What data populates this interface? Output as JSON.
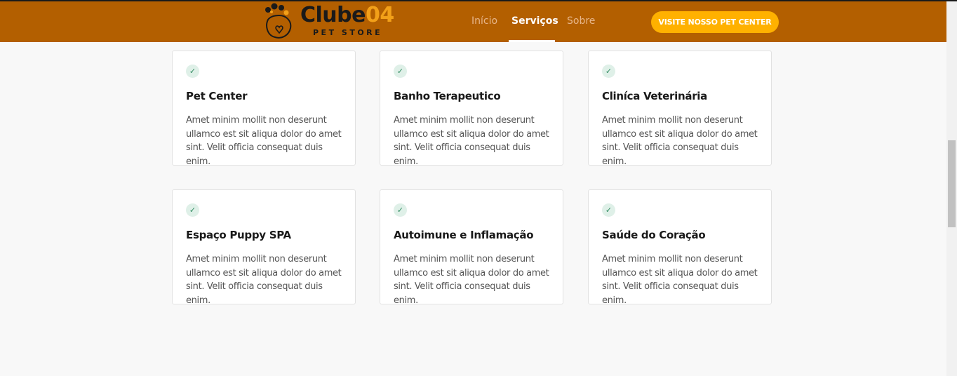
{
  "brand": {
    "name": "Clube",
    "name_number": "04",
    "tagline": "PET STORE"
  },
  "nav": {
    "items": [
      {
        "label": "Início",
        "active": false
      },
      {
        "label": "Serviços",
        "active": true
      },
      {
        "label": "Sobre",
        "active": false
      }
    ],
    "cta_label": "VISITE NOSSO PET CENTER"
  },
  "colors": {
    "header": "#b35f00",
    "cta": "#ffb100",
    "check_bg": "#dff0e8",
    "check": "#2f8a5f"
  },
  "services": [
    {
      "title": "Pet Center",
      "text": "Amet minim mollit non deserunt ullamco est sit aliqua dolor do amet sint. Velit officia consequat duis enim.",
      "icon": "check-icon"
    },
    {
      "title": "Banho Terapeutico",
      "text": "Amet minim mollit non deserunt ullamco est sit aliqua dolor do amet sint. Velit officia consequat duis enim.",
      "icon": "check-icon"
    },
    {
      "title": "Cliníca Veterinária",
      "text": "Amet minim mollit non deserunt ullamco est sit aliqua dolor do amet sint. Velit officia consequat duis enim.",
      "icon": "check-icon"
    },
    {
      "title": "Espaço Puppy SPA",
      "text": "Amet minim mollit non deserunt ullamco est sit aliqua dolor do amet sint. Velit officia consequat duis enim.",
      "icon": "check-icon"
    },
    {
      "title": "Autoimune e Inflamação",
      "text": "Amet minim mollit non deserunt ullamco est sit aliqua dolor do amet sint. Velit officia consequat duis enim.",
      "icon": "check-icon"
    },
    {
      "title": "Saúde do Coração",
      "text": "Amet minim mollit non deserunt ullamco est sit aliqua dolor do amet sint. Velit officia consequat duis enim.",
      "icon": "check-icon"
    }
  ],
  "check_glyph": "✓"
}
